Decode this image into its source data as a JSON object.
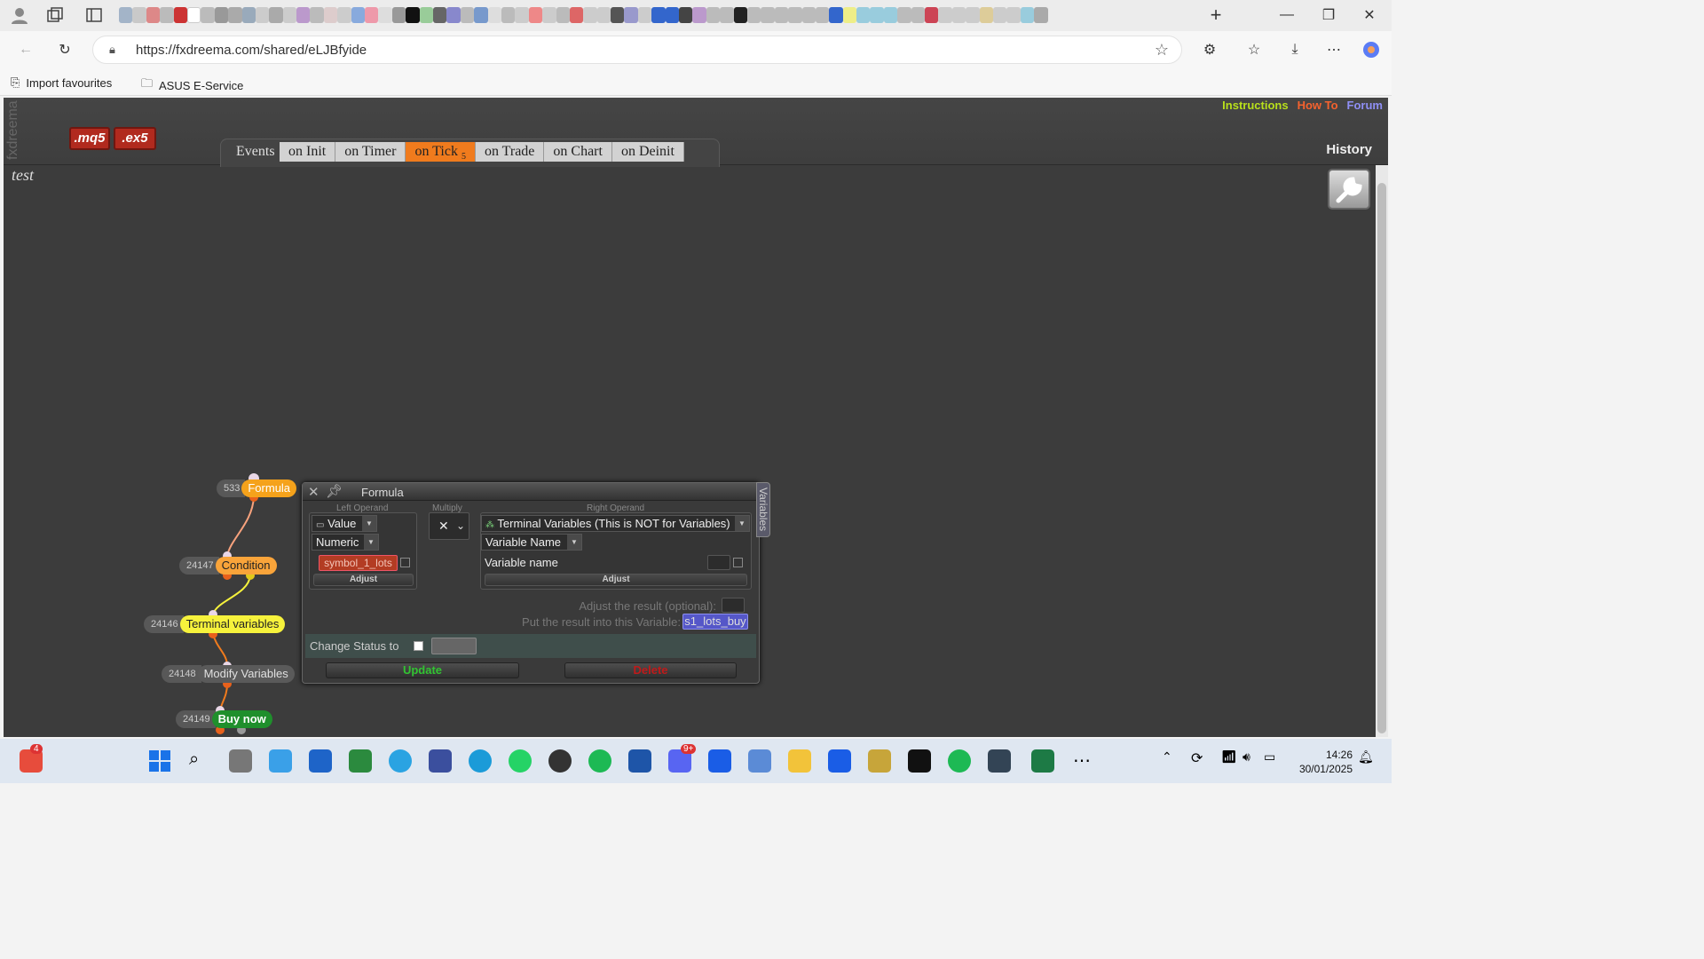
{
  "browser": {
    "url": "https://fxdreema.com/shared/eLJBfyide",
    "favourites": [
      "Import favourites",
      "ASUS E-Service"
    ]
  },
  "app": {
    "side_label": "fxdreema",
    "buttons": [
      ".mq5",
      ".ex5"
    ],
    "links": [
      "Instructions",
      "How To",
      "Forum"
    ],
    "history_label": "History",
    "events_label": "Events",
    "tabs": [
      {
        "label": "on Init",
        "badge": ""
      },
      {
        "label": "on Timer",
        "badge": ""
      },
      {
        "label": "on Tick",
        "badge": "5"
      },
      {
        "label": "on Trade",
        "badge": ""
      },
      {
        "label": "on Chart",
        "badge": ""
      },
      {
        "label": "on Deinit",
        "badge": ""
      }
    ],
    "project_title": "test"
  },
  "nodes": [
    {
      "id": "533",
      "name": "Formula",
      "color": "#f5a21b"
    },
    {
      "id": "24147",
      "name": "Condition",
      "color": "#f9a43a"
    },
    {
      "id": "24146",
      "name": "Terminal variables",
      "color": "#f6f23c"
    },
    {
      "id": "24148",
      "name": "Modify Variables",
      "color": "#5a5a5a"
    },
    {
      "id": "24149",
      "name": "Buy now",
      "color": "#1f8f2c"
    }
  ],
  "formula_panel": {
    "title": "Formula",
    "left_caption": "Left Operand",
    "mid_caption": "Multiply",
    "right_caption": "Right Operand",
    "left_type": "Value",
    "left_subtype": "Numeric",
    "left_value": "symbol_1_lots",
    "adjust_label": "Adjust",
    "operator_symbol": "✕",
    "right_type": "Terminal Variables (This is NOT for Variables)",
    "right_subtype": "Variable Name",
    "right_field_label": "Variable name",
    "adjust_result_label": "Adjust the result (optional):",
    "put_result_label": "Put the result into this Variable:",
    "result_variable": "s1_lots_buy",
    "change_status_label": "Change Status to",
    "update_label": "Update",
    "delete_label": "Delete",
    "variables_tab": "Variables"
  },
  "taskbar": {
    "badge": "4",
    "discord_badge": "9+",
    "time": "14:26",
    "date": "30/01/2025"
  }
}
